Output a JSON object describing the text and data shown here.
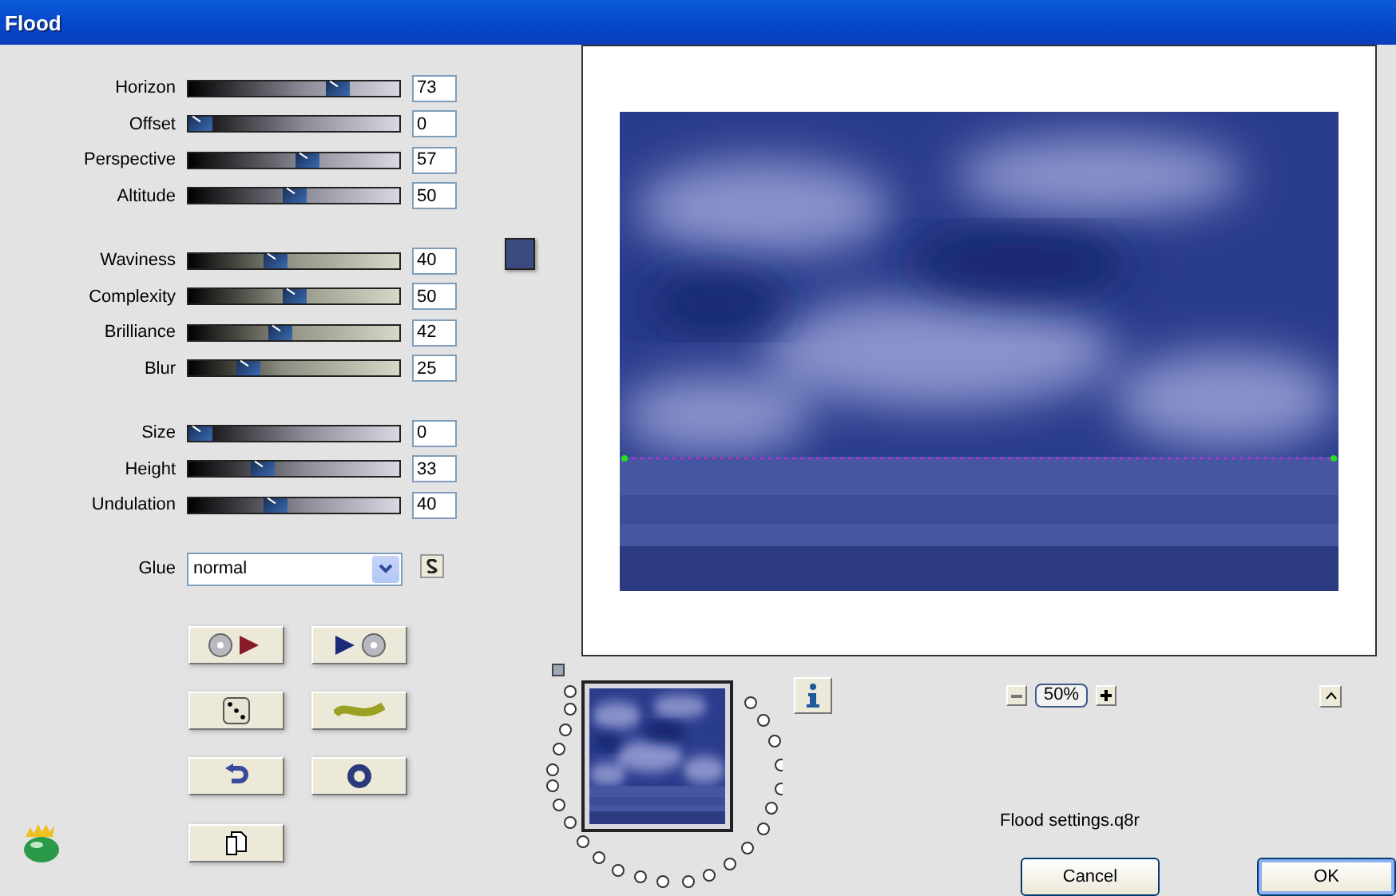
{
  "window": {
    "title": "Flood"
  },
  "slider_groups": [
    {
      "sliders": [
        {
          "label": "Horizon",
          "level": 0.73,
          "value": "73"
        },
        {
          "label": "Offset",
          "level": 0,
          "value": "0"
        },
        {
          "label": "Perspective",
          "level": 0.57,
          "value": "57"
        },
        {
          "label": "Altitude",
          "level": 0.5,
          "value": "50"
        }
      ]
    },
    {
      "sliders": [
        {
          "label": "Waviness",
          "level": 0.4,
          "value": "40"
        },
        {
          "label": "Complexity",
          "level": 0.5,
          "value": "50"
        },
        {
          "label": "Brilliance",
          "level": 0.42,
          "value": "42"
        },
        {
          "label": "Blur",
          "level": 0.25,
          "value": "25"
        }
      ]
    },
    {
      "sliders": [
        {
          "label": "Size",
          "level": 0,
          "value": "0"
        },
        {
          "label": "Height",
          "level": 0.33,
          "value": "33"
        },
        {
          "label": "Undulation",
          "level": 0.4,
          "value": "40"
        }
      ]
    }
  ],
  "color_swatch": {
    "color": "#3d4a80"
  },
  "glue": {
    "label": "Glue",
    "value": "normal"
  },
  "zoom": {
    "value": "50%"
  },
  "settings_file": "Flood settings.q8r",
  "buttons": [
    {
      "label": "Cancel",
      "default": false
    },
    {
      "label": "OK",
      "default": true
    }
  ]
}
